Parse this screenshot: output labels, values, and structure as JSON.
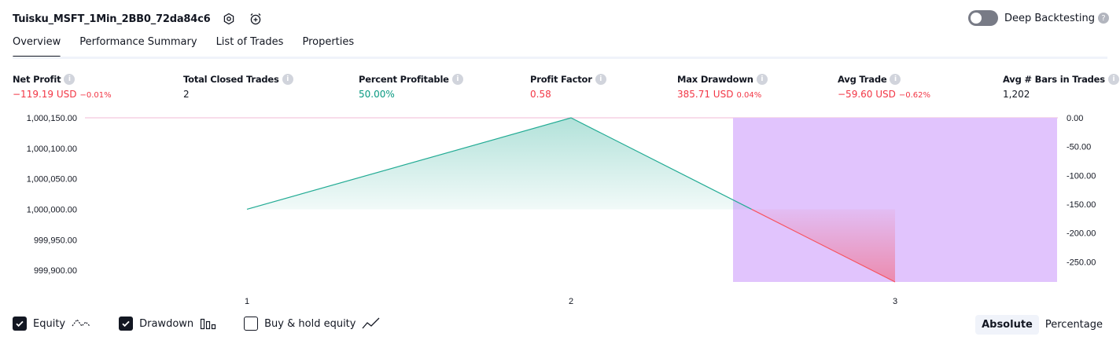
{
  "header": {
    "strategy_name": "Tuisku_MSFT_1Min_2BB0_72da84c6",
    "icons": [
      "settings-icon",
      "alarm-add-icon"
    ]
  },
  "deep_backtesting": {
    "label": "Deep Backtesting",
    "enabled": false
  },
  "tabs": [
    {
      "label": "Overview",
      "active": true
    },
    {
      "label": "Performance Summary",
      "active": false
    },
    {
      "label": "List of Trades",
      "active": false
    },
    {
      "label": "Properties",
      "active": false
    }
  ],
  "metrics": [
    {
      "label": "Net Profit",
      "value": "−119.19 USD",
      "pct": "−0.01%",
      "tone": "neg"
    },
    {
      "label": "Total Closed Trades",
      "value": "2",
      "pct": "",
      "tone": "neu"
    },
    {
      "label": "Percent Profitable",
      "value": "50.00%",
      "pct": "",
      "tone": "pos"
    },
    {
      "label": "Profit Factor",
      "value": "0.58",
      "pct": "",
      "tone": "neg"
    },
    {
      "label": "Max Drawdown",
      "value": "385.71 USD",
      "pct": "0.04%",
      "tone": "neg"
    },
    {
      "label": "Avg Trade",
      "value": "−59.60 USD",
      "pct": "−0.62%",
      "tone": "neg"
    },
    {
      "label": "Avg # Bars in Trades",
      "value": "1,202",
      "pct": "",
      "tone": "neu"
    }
  ],
  "chart_data": {
    "type": "area",
    "x": [
      1,
      2,
      3
    ],
    "equity": [
      1000000.0,
      1000150.0,
      999880.81
    ],
    "drawdown": [
      0.0,
      0.0,
      -285.0
    ],
    "left_axis": {
      "ticks": [
        "1,000,150.00",
        "1,000,100.00",
        "1,000,050.00",
        "1,000,000.00",
        "999,950.00",
        "999,900.00"
      ],
      "range": [
        999880.81,
        1000150.0
      ]
    },
    "right_axis": {
      "ticks": [
        "0.00",
        "-50.00",
        "-100.00",
        "-150.00",
        "-200.00",
        "-250.00"
      ],
      "range": [
        -285.0,
        0.0
      ]
    },
    "x_ticks": [
      "1",
      "2",
      "3"
    ],
    "colors": {
      "equity_up": "#22ab94",
      "equity_down": "#f7525f",
      "drawdown": "#e1c4fd",
      "zero_line": "#f0b8d4"
    }
  },
  "footer": {
    "checkboxes": [
      {
        "label": "Equity",
        "checked": true,
        "icon": "equity-line-icon"
      },
      {
        "label": "Drawdown",
        "checked": true,
        "icon": "drawdown-bars-icon"
      },
      {
        "label": "Buy & hold equity",
        "checked": false,
        "icon": "buy-hold-line-icon"
      }
    ],
    "modes": [
      {
        "label": "Absolute",
        "active": true
      },
      {
        "label": "Percentage",
        "active": false
      }
    ]
  }
}
